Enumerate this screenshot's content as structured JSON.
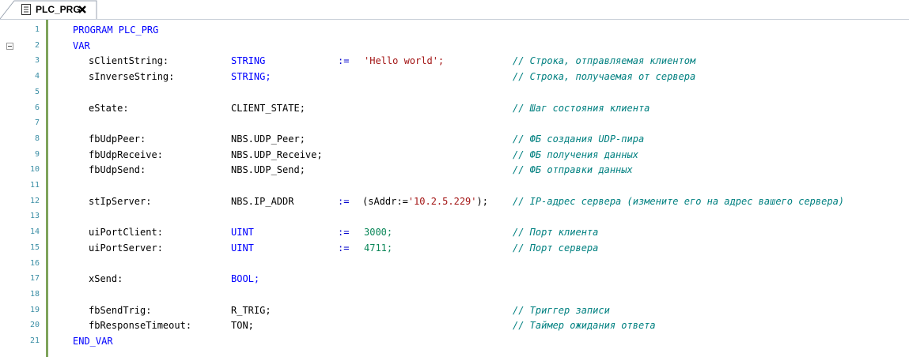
{
  "tab": {
    "title": "PLC_PRG",
    "icon": "document-icon",
    "close_icon": "close-icon"
  },
  "lines": [
    {
      "n": "1",
      "indent": 0,
      "decl": "PROGRAM PLC_PRG",
      "decl_kw": true
    },
    {
      "n": "2",
      "indent": 0,
      "decl": "VAR",
      "decl_kw": true,
      "fold": true
    },
    {
      "n": "3",
      "indent": 1,
      "name": "sClientString:",
      "type": "STRING",
      "type_kw": true,
      "assign": ":=",
      "value": "'Hello world';",
      "value_kind": "str",
      "comment": "// Строка, отправляемая клиентом"
    },
    {
      "n": "4",
      "indent": 1,
      "name": "sInverseString:",
      "type": "STRING;",
      "type_kw": true,
      "comment": "// Строка, получаемая от сервера"
    },
    {
      "n": "5"
    },
    {
      "n": "6",
      "indent": 1,
      "name": "eState:",
      "type": "CLIENT_STATE;",
      "comment": "// Шаг состояния клиента"
    },
    {
      "n": "7"
    },
    {
      "n": "8",
      "indent": 1,
      "name": "fbUdpPeer:",
      "type": "NBS.UDP_Peer;",
      "comment": "// ФБ создания UDP-пира"
    },
    {
      "n": "9",
      "indent": 1,
      "name": "fbUdpReceive:",
      "type": "NBS.UDP_Receive;",
      "comment": "// ФБ получения данных"
    },
    {
      "n": "10",
      "indent": 1,
      "name": "fbUdpSend:",
      "type": "NBS.UDP_Send;",
      "comment": "// ФБ отправки данных"
    },
    {
      "n": "11"
    },
    {
      "n": "12",
      "indent": 1,
      "name": "stIpServer:",
      "type": "NBS.IP_ADDR",
      "assign": ":=",
      "value_pre": "(sAddr:=",
      "value": "'10.2.5.229'",
      "value_kind": "str",
      "value_post": ");",
      "comment": "// IP-адрес сервера (измените его на адрес вашего сервера)"
    },
    {
      "n": "13"
    },
    {
      "n": "14",
      "indent": 1,
      "name": "uiPortClient:",
      "type": "UINT",
      "type_kw": true,
      "assign": ":=",
      "value": "3000;",
      "value_kind": "num",
      "comment": "// Порт клиента"
    },
    {
      "n": "15",
      "indent": 1,
      "name": "uiPortServer:",
      "type": "UINT",
      "type_kw": true,
      "assign": ":=",
      "value": "4711;",
      "value_kind": "num",
      "comment": "// Порт сервера"
    },
    {
      "n": "16"
    },
    {
      "n": "17",
      "indent": 1,
      "name": "xSend:",
      "type": "BOOL;",
      "type_kw": true
    },
    {
      "n": "18"
    },
    {
      "n": "19",
      "indent": 1,
      "name": "fbSendTrig:",
      "type": "R_TRIG;",
      "comment": "// Триггер записи"
    },
    {
      "n": "20",
      "indent": 1,
      "name": "fbResponseTimeout:",
      "type": "TON;",
      "comment": "// Таймер ожидания ответа"
    },
    {
      "n": "21",
      "indent": 0,
      "decl": "END_VAR",
      "decl_kw": true
    }
  ]
}
